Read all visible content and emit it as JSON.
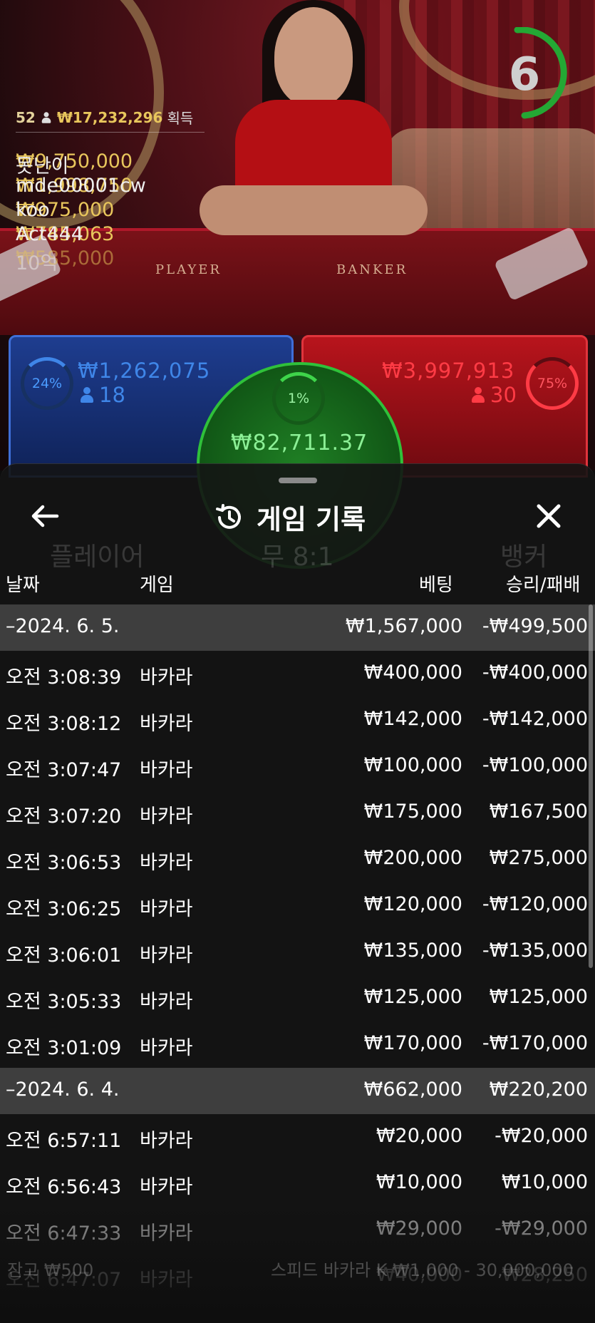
{
  "stream": {
    "countdown": "6",
    "table_labels": {
      "player": "PLAYER",
      "banker": "BANKER"
    }
  },
  "leaderboard": {
    "count": "52",
    "total": "₩17,232,296",
    "total_suffix": "획득",
    "rows": [
      {
        "amount": "₩9,750,000",
        "name": "못난이"
      },
      {
        "amount": "₩1,998,750",
        "name": "mde00001cw"
      },
      {
        "amount": "₩975,000",
        "name": "koo"
      },
      {
        "amount": "₩785,063",
        "name": "Act444"
      },
      {
        "amount": "₩585,000",
        "name": "10억"
      }
    ]
  },
  "bets": {
    "player": {
      "percent": "24%",
      "amount": "₩1,262,075",
      "players": "18",
      "color": "#3f86e8"
    },
    "tie": {
      "percent": "1%",
      "amount": "₩82,711.37",
      "color": "#2fc13a"
    },
    "banker": {
      "percent": "75%",
      "amount": "₩3,997,913",
      "players": "30",
      "color": "#e0343c"
    }
  },
  "background_ghosts": {
    "player_label": "플레이어",
    "tie_label": "무 8:1",
    "banker_label": "뱅커",
    "footer_left": "잔고 ₩500",
    "footer_right": "스피드 바카라 K ₩1,000 - 30,000,000"
  },
  "history": {
    "title": "게임 기록",
    "back_icon": "arrow-left-icon",
    "history_icon": "history-icon",
    "close_icon": "close-icon",
    "columns": {
      "date": "날짜",
      "game": "게임",
      "bet": "베팅",
      "result": "승리/패배"
    },
    "rows": [
      {
        "type": "date",
        "time": "–2024. 6. 5.",
        "game": "",
        "bet": "₩1,567,000",
        "result": "-₩499,500"
      },
      {
        "type": "item",
        "time": "오전 3:08:39",
        "game": "바카라",
        "bet": "₩400,000",
        "result": "-₩400,000"
      },
      {
        "type": "item",
        "time": "오전 3:08:12",
        "game": "바카라",
        "bet": "₩142,000",
        "result": "-₩142,000"
      },
      {
        "type": "item",
        "time": "오전 3:07:47",
        "game": "바카라",
        "bet": "₩100,000",
        "result": "-₩100,000"
      },
      {
        "type": "item",
        "time": "오전 3:07:20",
        "game": "바카라",
        "bet": "₩175,000",
        "result": "₩167,500"
      },
      {
        "type": "item",
        "time": "오전 3:06:53",
        "game": "바카라",
        "bet": "₩200,000",
        "result": "₩275,000"
      },
      {
        "type": "item",
        "time": "오전 3:06:25",
        "game": "바카라",
        "bet": "₩120,000",
        "result": "-₩120,000"
      },
      {
        "type": "item",
        "time": "오전 3:06:01",
        "game": "바카라",
        "bet": "₩135,000",
        "result": "-₩135,000"
      },
      {
        "type": "item",
        "time": "오전 3:05:33",
        "game": "바카라",
        "bet": "₩125,000",
        "result": "₩125,000"
      },
      {
        "type": "item",
        "time": "오전 3:01:09",
        "game": "바카라",
        "bet": "₩170,000",
        "result": "-₩170,000"
      },
      {
        "type": "date",
        "time": "–2024. 6. 4.",
        "game": "",
        "bet": "₩662,000",
        "result": "₩220,200"
      },
      {
        "type": "item",
        "time": "오전 6:57:11",
        "game": "바카라",
        "bet": "₩20,000",
        "result": "-₩20,000"
      },
      {
        "type": "item",
        "time": "오전 6:56:43",
        "game": "바카라",
        "bet": "₩10,000",
        "result": "₩10,000"
      },
      {
        "type": "item",
        "time": "오전 6:47:33",
        "game": "바카라",
        "bet": "₩29,000",
        "result": "-₩29,000"
      },
      {
        "type": "item",
        "time": "오전 6:47:07",
        "game": "바카라",
        "bet": "₩40,000",
        "result": "₩28,250"
      }
    ]
  }
}
